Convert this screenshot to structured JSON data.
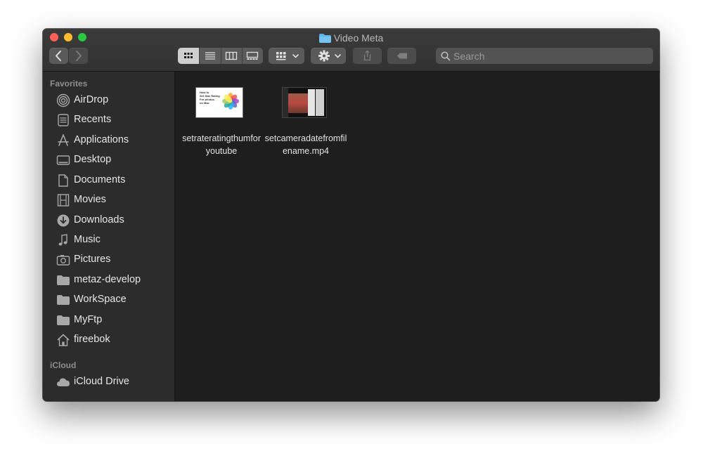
{
  "window": {
    "title": "Video Meta"
  },
  "toolbar": {
    "search_placeholder": "Search"
  },
  "sidebar": {
    "favorites_title": "Favorites",
    "favorites": [
      {
        "label": "AirDrop",
        "icon": "airdrop-icon"
      },
      {
        "label": "Recents",
        "icon": "recents-icon"
      },
      {
        "label": "Applications",
        "icon": "applications-icon"
      },
      {
        "label": "Desktop",
        "icon": "desktop-icon"
      },
      {
        "label": "Documents",
        "icon": "documents-icon"
      },
      {
        "label": "Movies",
        "icon": "movies-icon"
      },
      {
        "label": "Downloads",
        "icon": "downloads-icon"
      },
      {
        "label": "Music",
        "icon": "music-icon"
      },
      {
        "label": "Pictures",
        "icon": "pictures-icon"
      },
      {
        "label": "metaz-develop",
        "icon": "folder-icon"
      },
      {
        "label": "WorkSpace",
        "icon": "folder-icon"
      },
      {
        "label": "MyFtp",
        "icon": "folder-icon"
      },
      {
        "label": "fireebok",
        "icon": "home-icon"
      }
    ],
    "icloud_title": "iCloud",
    "icloud": [
      {
        "label": "iCloud Drive",
        "icon": "cloud-icon"
      }
    ]
  },
  "files": [
    {
      "name": "setrateratingthumforyoutube",
      "thumb_lines": [
        "How to",
        "Set Star Rating",
        "For photos",
        "on Mac"
      ]
    },
    {
      "name": "setcameradatefromfilename.mp4"
    }
  ],
  "colors": {
    "accent_folder": "#5fb3e8",
    "window_bg": "#1e1e1e",
    "sidebar_bg": "#2c2c2c"
  }
}
